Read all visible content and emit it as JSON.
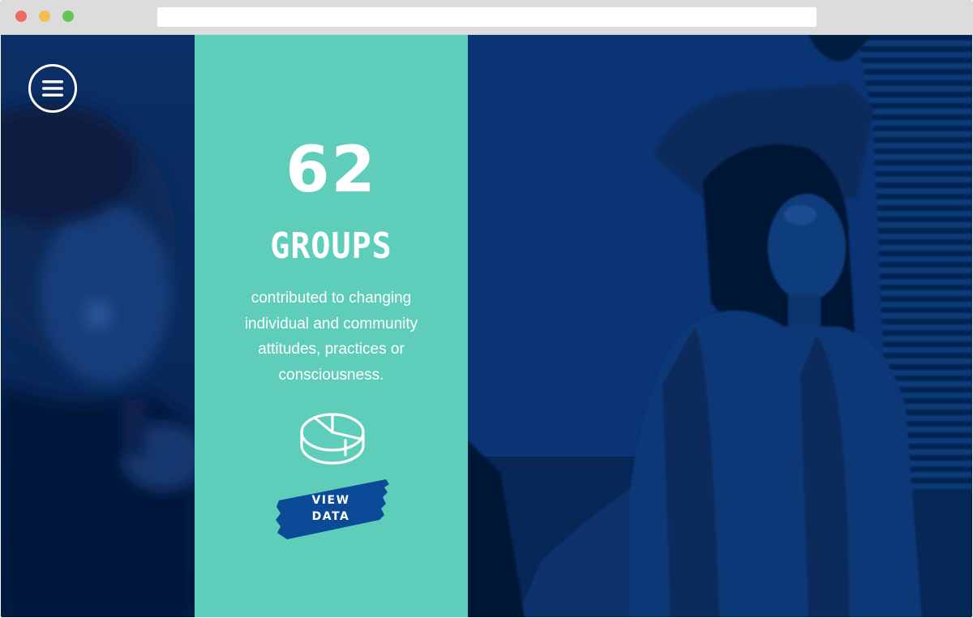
{
  "window": {
    "controls": [
      "close",
      "minimize",
      "maximize"
    ],
    "address_bar": ""
  },
  "menu": {
    "icon": "hamburger-menu-icon"
  },
  "stat": {
    "number": "62",
    "label": "GROUPS",
    "description": "contributed to changing individual and community attitudes, practices or consciousness.",
    "icon": "pie-chart-icon"
  },
  "cta": {
    "label_line1": "VIEW",
    "label_line2": "DATA"
  },
  "colors": {
    "panel": "#5ecdb9",
    "photo_tint": "#08306f",
    "button": "#0b4a97",
    "text": "#ffffff"
  }
}
